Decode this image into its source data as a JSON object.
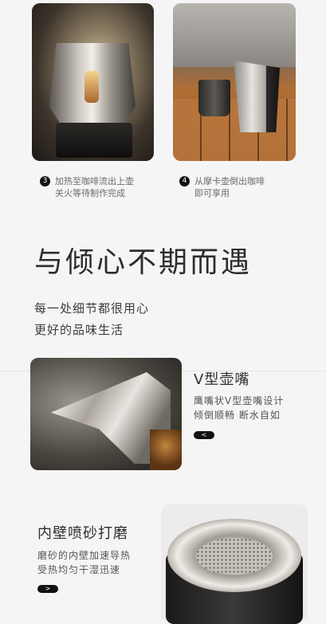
{
  "steps": [
    {
      "number": "3",
      "line1": "加热至咖啡流出上壶",
      "line2": "关火等待制作完成"
    },
    {
      "number": "4",
      "line1": "从摩卡壶倒出咖啡",
      "line2": "即可享用"
    }
  ],
  "hero": {
    "headline": "与倾心不期而遇",
    "sub1": "每一处细节都很用心",
    "sub2": "更好的品味生活"
  },
  "feature_spout": {
    "title": "V型壶嘴",
    "desc1": "鹰嘴状V型壶嘴设计",
    "desc2": "倾倒顺畅 断水自如",
    "arrow": "<"
  },
  "feature_wall": {
    "title": "内壁喷砂打磨",
    "desc1": "磨砂的内壁加速导热",
    "desc2": "受热均匀干湿迅速",
    "arrow": ">"
  },
  "colors": {
    "background": "#f5f5f5",
    "accent": "#111111",
    "text": "#333333"
  }
}
